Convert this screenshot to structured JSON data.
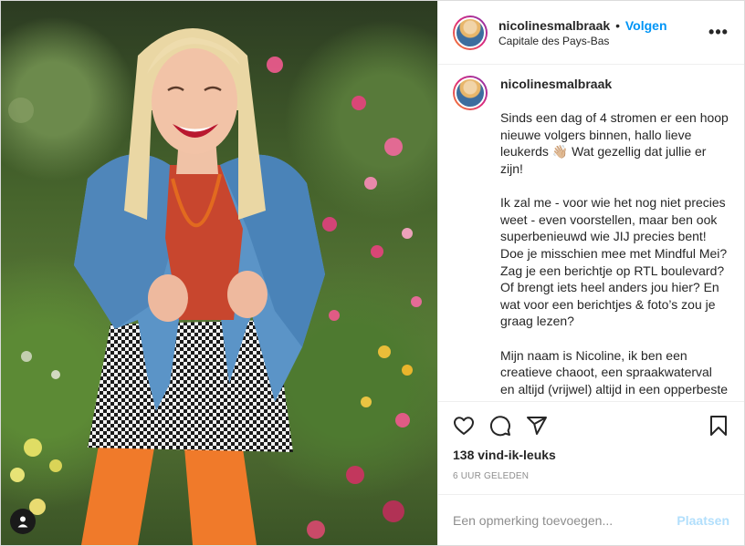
{
  "post": {
    "username": "nicolinesmalbraak",
    "follow_label": "Volgen",
    "separator": "•",
    "location": "Capitale des Pays-Bas",
    "more_label": "•••",
    "caption": {
      "author": "nicolinesmalbraak",
      "paragraphs": [
        "Sinds een dag of 4 stromen er een hoop nieuwe volgers binnen, hallo lieve leukerds 👋🏼 Wat gezellig dat jullie er zijn!",
        "Ik zal me - voor wie het nog niet precies weet - even voorstellen, maar ben ook superbenieuwd wie JIJ precies bent! Doe je misschien mee met Mindful Mei? Zag je een berichtje op RTL boulevard? Of brengt iets heel anders jou hier? En wat voor een berichtjes & foto’s zou je graag lezen?",
        "Mijn naam is Nicoline, ik ben een creatieve chaoot, een spraakwaterval en altijd (vrijwel) altijd in een opperbeste stemming. Ik heb een bedrijf als trainer & coach, maar ben eigenlijk filosoof."
      ]
    },
    "likes": "138 vind-ik-leuks",
    "time": "6 UUR GELEDEN",
    "comment_placeholder": "Een opmerking toevoegen...",
    "post_button": "Plaatsen"
  },
  "icons": {
    "like": "heart-icon",
    "comment": "comment-icon",
    "share": "paper-plane-icon",
    "save": "bookmark-icon",
    "user_tag": "user-icon"
  },
  "colors": {
    "follow": "#0095f6",
    "post_button_disabled": "#b2dffc",
    "muted": "#8e8e8e",
    "text": "#262626"
  }
}
